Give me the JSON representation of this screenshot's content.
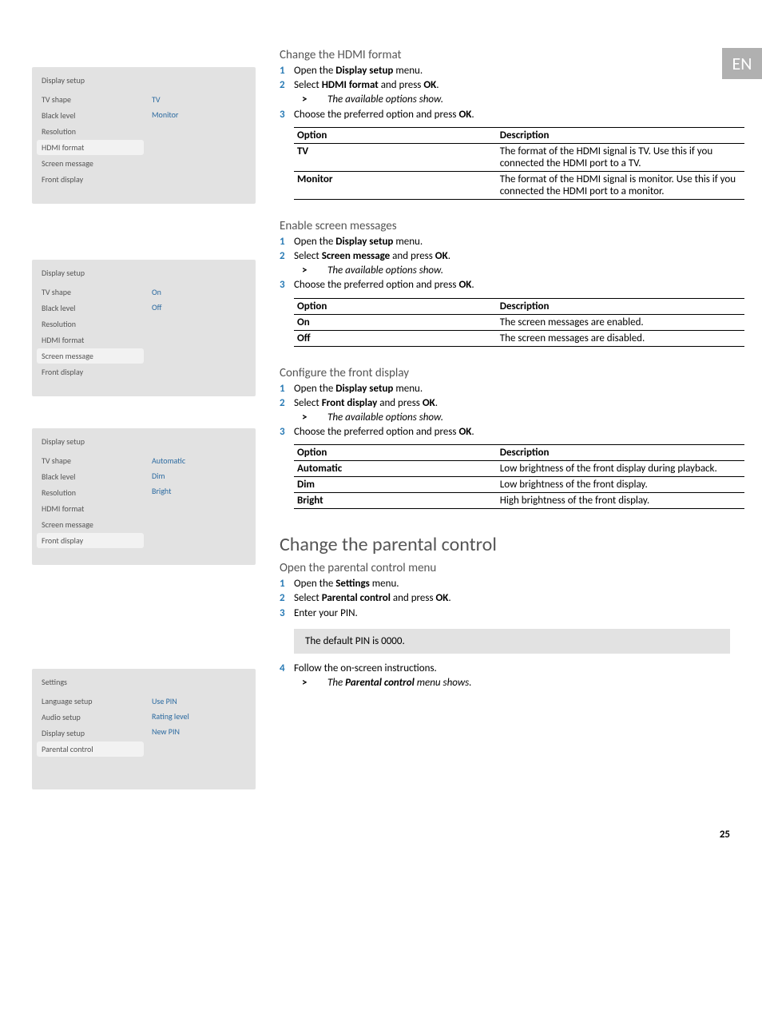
{
  "lang_tab": "EN",
  "page_number": "25",
  "menu_hdmi": {
    "title": "Display setup",
    "items": [
      "TV shape",
      "Black level",
      "Resolution",
      "HDMI format",
      "Screen message",
      "Front display"
    ],
    "selected_index": 3,
    "options": [
      "TV",
      "Monitor"
    ]
  },
  "menu_screenmsg": {
    "title": "Display setup",
    "items": [
      "TV shape",
      "Black level",
      "Resolution",
      "HDMI format",
      "Screen message",
      "Front display"
    ],
    "selected_index": 4,
    "options": [
      "On",
      "Off"
    ]
  },
  "menu_frontdisp": {
    "title": "Display setup",
    "items": [
      "TV shape",
      "Black level",
      "Resolution",
      "HDMI format",
      "Screen message",
      "Front display"
    ],
    "selected_index": 5,
    "options": [
      "Automatic",
      "Dim",
      "Bright"
    ]
  },
  "menu_settings": {
    "title": "Settings",
    "items": [
      "Language setup",
      "Audio setup",
      "Display setup",
      "Parental control"
    ],
    "selected_index": 3,
    "options": [
      "Use PIN",
      "Rating level",
      "New PIN"
    ]
  },
  "sec_hdmi": {
    "heading": "Change the HDMI format",
    "step1_pre": "Open the ",
    "step1_bold": "Display setup",
    "step1_post": " menu.",
    "step2_pre": "Select ",
    "step2_bold": "HDMI format",
    "step2_mid": " and press ",
    "step2_bold2": "OK",
    "step2_post": ".",
    "step2_sub": "The available options show.",
    "step3_pre": "Choose the preferred option and press ",
    "step3_bold": "OK",
    "step3_post": ".",
    "th1": "Option",
    "th2": "Description",
    "r1c1": "TV",
    "r1c2": "The format of the HDMI signal is TV. Use this if you connected the HDMI port to a TV.",
    "r2c1": "Monitor",
    "r2c2": "The format of the HDMI signal is monitor. Use this if you connected the HDMI port to a monitor."
  },
  "sec_screen": {
    "heading": "Enable screen messages",
    "step1_pre": "Open the ",
    "step1_bold": "Display setup",
    "step1_post": " menu.",
    "step2_pre": "Select ",
    "step2_bold": "Screen message",
    "step2_mid": " and press ",
    "step2_bold2": "OK",
    "step2_post": ".",
    "step2_sub": "The available options show.",
    "step3_pre": "Choose the preferred option and press ",
    "step3_bold": "OK",
    "step3_post": ".",
    "th1": "Option",
    "th2": "Description",
    "r1c1": "On",
    "r1c2": "The screen messages are enabled.",
    "r2c1": "Off",
    "r2c2": "The screen messages are disabled."
  },
  "sec_front": {
    "heading": "Configure the front display",
    "step1_pre": "Open the ",
    "step1_bold": "Display setup",
    "step1_post": " menu.",
    "step2_pre": "Select ",
    "step2_bold": "Front display",
    "step2_mid": " and press ",
    "step2_bold2": "OK",
    "step2_post": ".",
    "step2_sub": "The available options show.",
    "step3_pre": "Choose the preferred option and press ",
    "step3_bold": "OK",
    "step3_post": ".",
    "th1": "Option",
    "th2": "Description",
    "r1c1": "Automatic",
    "r1c2": "Low brightness of the front display during playback.",
    "r2c1": "Dim",
    "r2c2": "Low brightness of the front display.",
    "r3c1": "Bright",
    "r3c2": "High brightness of the front display."
  },
  "sec_parental": {
    "heading": "Change the parental control",
    "sub_heading": "Open the parental control menu",
    "step1_pre": "Open the ",
    "step1_bold": "Settings",
    "step1_post": " menu.",
    "step2_pre": "Select ",
    "step2_bold": "Parental control",
    "step2_mid": " and press ",
    "step2_bold2": "OK",
    "step2_post": ".",
    "step3": "Enter your PIN.",
    "note": "The default PIN is 0000.",
    "step4": "Follow the on-screen instructions.",
    "step4_sub_pre": "The ",
    "step4_sub_bold": "Parental control",
    "step4_sub_post": " menu shows."
  },
  "nums": {
    "n1": "1",
    "n2": "2",
    "n3": "3",
    "n4": "4"
  },
  "gt": ">"
}
